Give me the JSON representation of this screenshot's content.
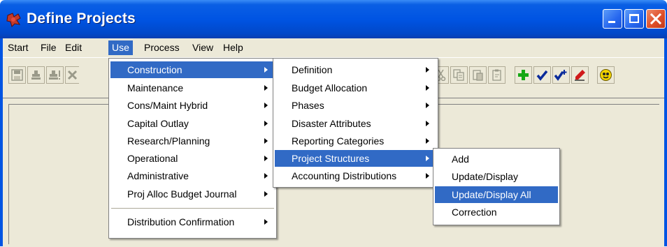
{
  "window": {
    "title": "Define Projects",
    "icon": "app-icon",
    "controls": [
      "minimize-icon",
      "maximize-icon",
      "close-icon"
    ]
  },
  "menubar": {
    "items": [
      "Start",
      "File",
      "Edit",
      "Use",
      "Process",
      "View",
      "Help"
    ],
    "active": "Use"
  },
  "use_menu": {
    "items": [
      {
        "label": "Construction",
        "submenu": true,
        "highlighted": true
      },
      {
        "label": "Maintenance",
        "submenu": true
      },
      {
        "label": "Cons/Maint Hybrid",
        "submenu": true
      },
      {
        "label": "Capital Outlay",
        "submenu": true
      },
      {
        "label": "Research/Planning",
        "submenu": true
      },
      {
        "label": "Operational",
        "submenu": true
      },
      {
        "label": "Administrative",
        "submenu": true
      },
      {
        "label": "Proj Alloc Budget Journal",
        "submenu": true
      },
      {
        "label": "Distribution Confirmation",
        "submenu": true
      }
    ]
  },
  "construction_menu": {
    "items": [
      {
        "label": "Definition",
        "submenu": true
      },
      {
        "label": "Budget Allocation",
        "submenu": true
      },
      {
        "label": "Phases",
        "submenu": true
      },
      {
        "label": "Disaster Attributes",
        "submenu": true
      },
      {
        "label": "Reporting Categories",
        "submenu": true
      },
      {
        "label": "Project Structures",
        "submenu": true,
        "highlighted": true
      },
      {
        "label": "Accounting Distributions",
        "submenu": true
      }
    ]
  },
  "structures_menu": {
    "items": [
      {
        "label": "Add"
      },
      {
        "label": "Update/Display"
      },
      {
        "label": "Update/Display All",
        "highlighted": true
      },
      {
        "label": "Correction"
      }
    ]
  },
  "toolbar": {
    "left_icons": [
      "save-icon",
      "stamp-icon",
      "stamp-exclaim-icon",
      "delete-icon"
    ],
    "right_icons": [
      "cut-icon",
      "copy-icon",
      "paste-icon",
      "clipboard-icon",
      "add-icon",
      "check-icon",
      "check-plus-icon",
      "edit-pencil-icon",
      "help-icon"
    ]
  },
  "colors": {
    "highlight": "#316ac5",
    "titlebar": "#0054e3",
    "face": "#ece9d8"
  }
}
